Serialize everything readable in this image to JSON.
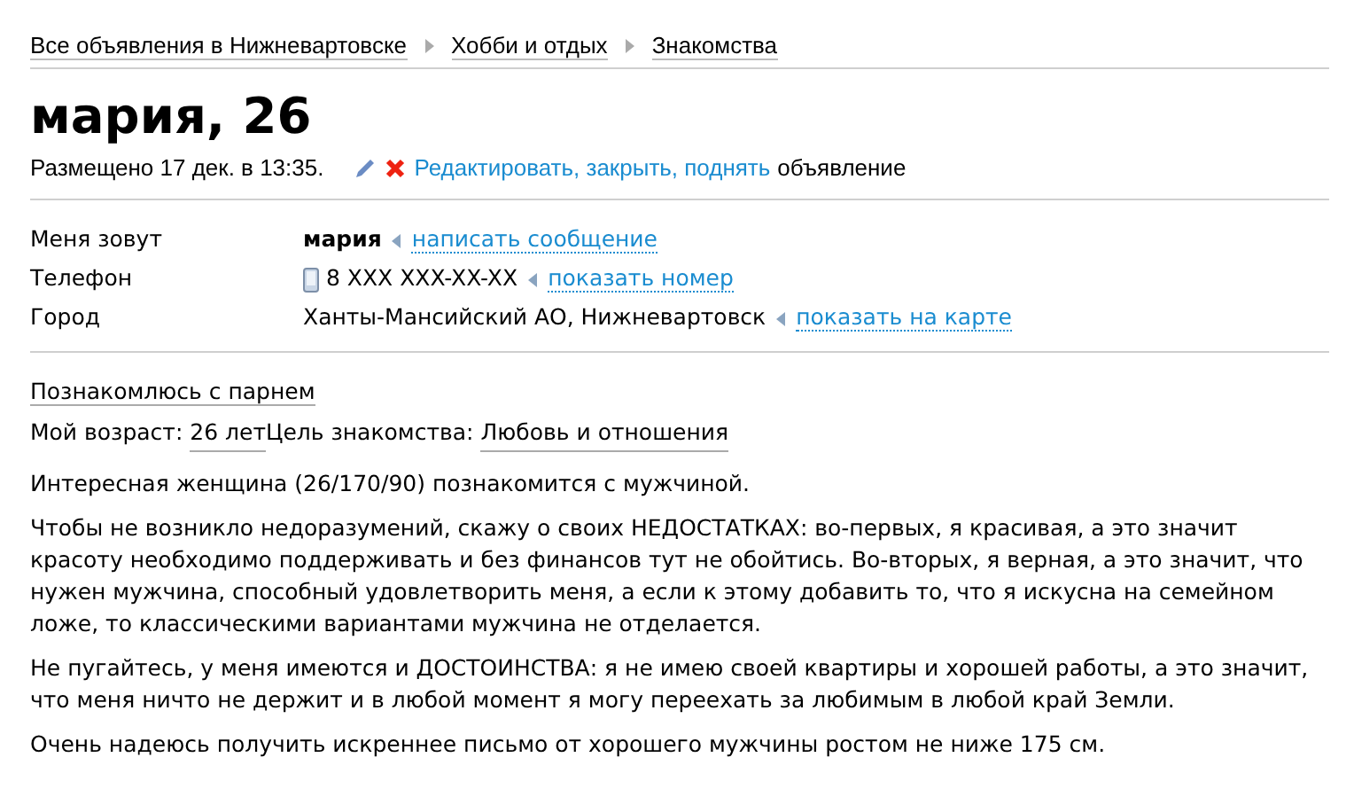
{
  "breadcrumbs": [
    "Все объявления в Нижневартовске",
    "Хобби и отдых",
    "Знакомства"
  ],
  "title": "мария, 26",
  "posted": "Размещено 17 дек. в 13:35.",
  "manage": {
    "link": "Редактировать, закрыть, поднять",
    "text": "объявление"
  },
  "details": [
    {
      "kind": "name",
      "label": "Меня зовут",
      "value": "мария",
      "link": "написать сообщение"
    },
    {
      "kind": "phone",
      "label": "Телефон",
      "value": "8 XXX XXX-XX-XX",
      "link": "показать номер"
    },
    {
      "kind": "city",
      "label": "Город",
      "value": "Ханты-Мансийский АО, Нижневартовск",
      "link": "показать на карте"
    }
  ],
  "category": "Познакомлюсь с парнем",
  "params": [
    {
      "label": "Мой возраст:",
      "value": "26 лет"
    },
    {
      "label": "Цель знакомства:",
      "value": "Любовь и отношения"
    }
  ],
  "paragraphs": [
    "Интересная женщина (26/170/90) познакомится с мужчиной.",
    "Чтобы не возникло недоразумений, скажу о своих НЕДОСТАТКАХ: во-первых, я красивая, а это значит красоту необходимо поддерживать и без финансов тут не обойтись. Во-вторых, я верная, а это значит, что нужен мужчина, способный удовлетворить меня, а если к этому добавить то, что я искусна на семейном ложе, то классическими вариантами мужчина не отделается.",
    "Не пугайтесь, у меня имеются и ДОСТОИНСТВА: я не имею своей квартиры и хорошей работы, а это значит, что меня ничто не держит и в любой момент я могу переехать за любимым в любой край Земли.",
    "Очень надеюсь получить искреннее письмо от хорошего мужчины ростом не ниже 175 см."
  ]
}
